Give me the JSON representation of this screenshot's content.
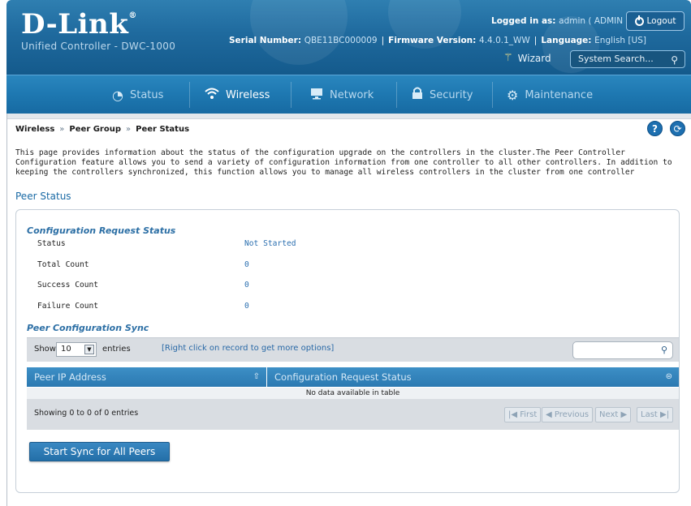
{
  "header": {
    "brand": "D-Link",
    "brand_mark": "®",
    "product": "Unified Controller - DWC-1000",
    "logged_in_label": "Logged in as:",
    "logged_in_user": "admin ( ADMIN )",
    "logout_label": "Logout",
    "serial_label": "Serial Number:",
    "serial_value": "QBE11BC000009",
    "firmware_label": "Firmware Version:",
    "firmware_value": "4.4.0.1_WW",
    "language_label": "Language:",
    "language_value": "English [US]",
    "wizard_label": "Wizard",
    "system_search_placeholder": "System Search..."
  },
  "nav": {
    "items": [
      {
        "label": "Status",
        "icon": "gauge-icon",
        "active": false
      },
      {
        "label": "Wireless",
        "icon": "wifi-icon",
        "active": true
      },
      {
        "label": "Network",
        "icon": "monitor-icon",
        "active": false
      },
      {
        "label": "Security",
        "icon": "lock-icon",
        "active": false
      },
      {
        "label": "Maintenance",
        "icon": "gears-icon",
        "active": false
      }
    ]
  },
  "breadcrumb": {
    "items": [
      "Wireless",
      "Peer Group",
      "Peer Status"
    ],
    "separator": "»"
  },
  "page": {
    "description": "This page provides information about the status of the configuration upgrade on the controllers in the cluster.The Peer Controller Configuration feature allows you to send a variety of configuration information from one controller to all other controllers. In addition to keeping the controllers synchronized, this function allows you to manage all wireless controllers in the cluster from one controller",
    "section_title": "Peer Status"
  },
  "config_request": {
    "heading": "Configuration Request Status",
    "rows": [
      {
        "label": "Status",
        "value": "Not Started"
      },
      {
        "label": "Total Count",
        "value": "0"
      },
      {
        "label": "Success Count",
        "value": "0"
      },
      {
        "label": "Failure Count",
        "value": "0"
      }
    ]
  },
  "peer_sync": {
    "heading": "Peer Configuration Sync",
    "show_label": "Show",
    "show_value": "10",
    "entries_label": "entries",
    "right_click_hint": "[Right click on record to get more options]",
    "columns": [
      "Peer IP Address",
      "Configuration Request Status"
    ],
    "no_data": "No data available in table",
    "showing": "Showing 0 to 0 of 0 entries",
    "pagination": {
      "first": "First",
      "previous": "Previous",
      "next": "Next",
      "last": "Last"
    },
    "start_button": "Start Sync for All Peers"
  },
  "colors": {
    "header_blue": "#1f6a9e",
    "nav_blue": "#1e78b1",
    "link_blue": "#2b6fb0",
    "table_header": "#2b79b1"
  }
}
